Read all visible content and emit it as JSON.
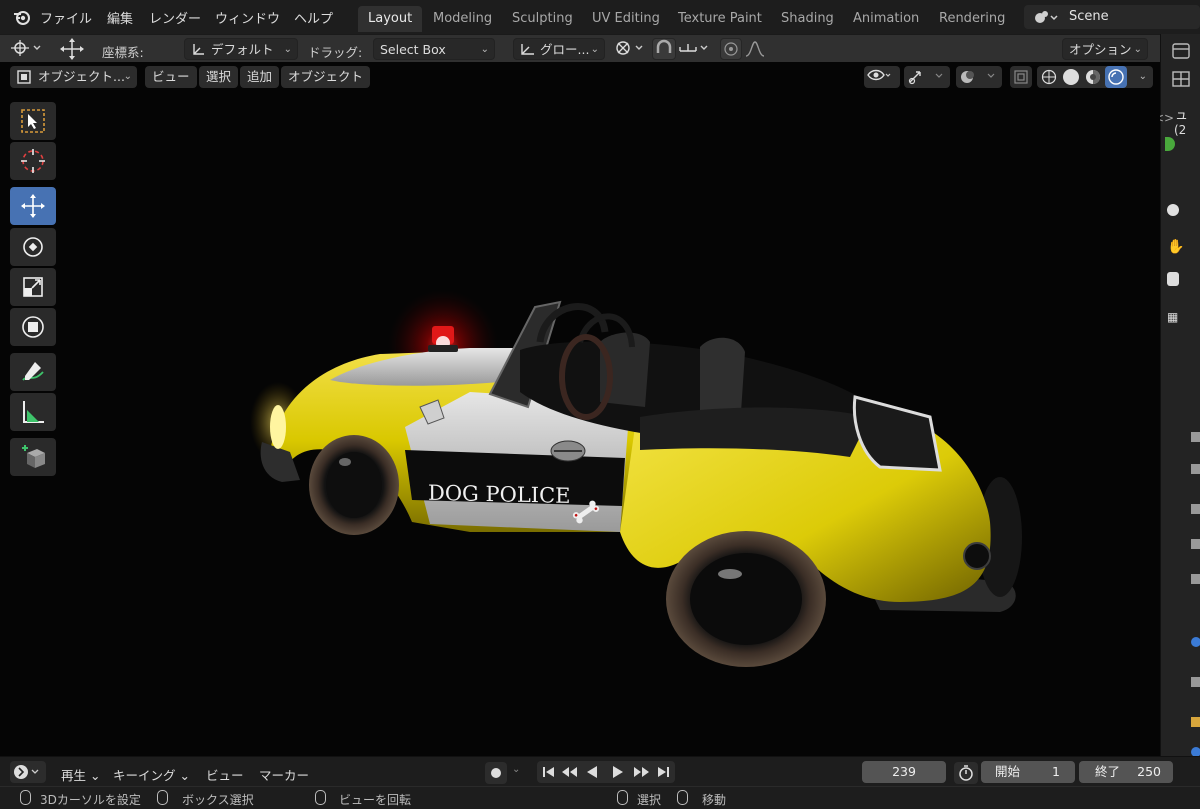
{
  "menu": {
    "file": "ファイル",
    "edit": "編集",
    "render": "レンダー",
    "window": "ウィンドウ",
    "help": "ヘルプ"
  },
  "workspaces": [
    "Layout",
    "Modeling",
    "Sculpting",
    "UV Editing",
    "Texture Paint",
    "Shading",
    "Animation",
    "Rendering"
  ],
  "active_workspace": "Layout",
  "scene": {
    "name": "Scene"
  },
  "tool_settings": {
    "orientation_label": "座標系:",
    "orientation_value": "デフォルト",
    "drag_label": "ドラッグ:",
    "drag_value": "Select Box",
    "pivot_value": "グロー...",
    "options_label": "オプション"
  },
  "viewport_header": {
    "mode": "オブジェクト...",
    "view": "ビュー",
    "select": "選択",
    "add": "追加",
    "object": "オブジェクト"
  },
  "right_panel_partial": {
    "char": "ュ",
    "num": "(2"
  },
  "car_decal": "DOG POLICE",
  "timeline": {
    "playback": "再生",
    "keying": "キーイング",
    "view": "ビュー",
    "marker": "マーカー",
    "current_frame": "239",
    "start_label": "開始",
    "start_value": "1",
    "end_label": "終了",
    "end_value": "250"
  },
  "status": {
    "set_cursor": "3Dカーソルを設定",
    "box_select": "ボックス選択",
    "rotate_view": "ビューを回転",
    "select": "選択",
    "move": "移動"
  },
  "colors": {
    "accent": "#4772b3",
    "car_yellow": "#e6d400",
    "siren_red": "#ff2020"
  }
}
